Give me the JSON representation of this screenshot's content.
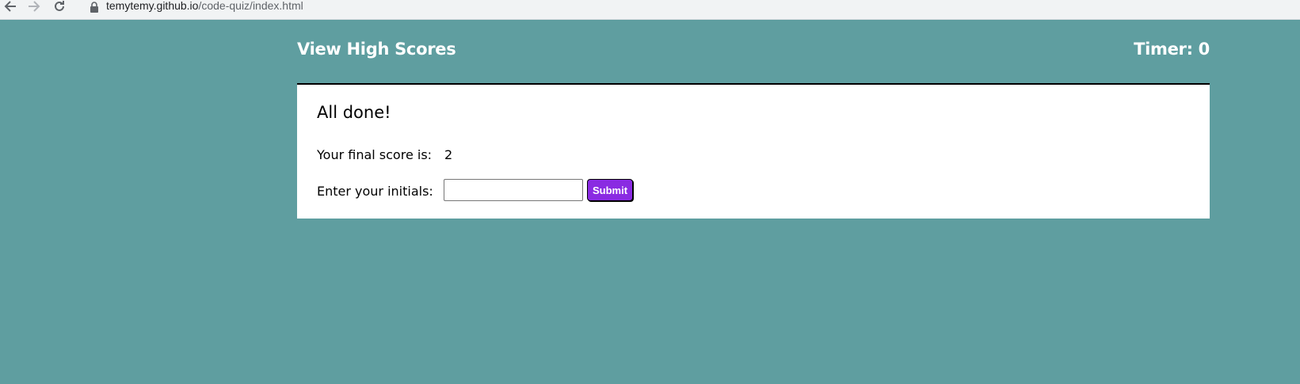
{
  "browser": {
    "url_host": "temytemy.github.io",
    "url_path": "/code-quiz/index.html",
    "icons": [
      "back-arrow-icon",
      "forward-arrow-icon",
      "reload-icon",
      "lock-icon"
    ]
  },
  "header": {
    "high_scores_label": "View High Scores",
    "timer_label": "Timer: 0"
  },
  "card": {
    "title": "All done!",
    "score_label": "Your final score is:",
    "score_value": "2",
    "initials_label": "Enter your initials:",
    "initials_value": "",
    "initials_placeholder": "",
    "submit_label": "Submit"
  },
  "colors": {
    "page_background": "#5f9ea0",
    "card_background": "#ffffff",
    "submit_button": "#8a2be2",
    "header_text": "#ffffff"
  }
}
